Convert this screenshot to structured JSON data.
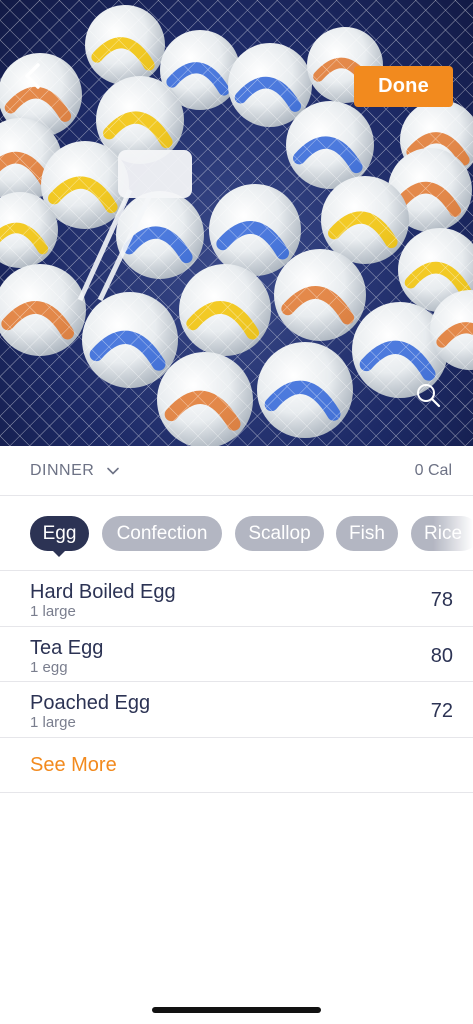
{
  "header": {
    "back_icon": "chevron-left-icon",
    "done_label": "Done",
    "search_icon": "search-icon"
  },
  "meal": {
    "name": "DINNER",
    "dropdown_icon": "chevron-down-icon",
    "calories": "0 Cal"
  },
  "chips": [
    {
      "label": "Egg",
      "active": true
    },
    {
      "label": "Confection",
      "active": false
    },
    {
      "label": "Scallop",
      "active": false
    },
    {
      "label": "Fish",
      "active": false
    },
    {
      "label": "Rice",
      "active": false
    }
  ],
  "foods": [
    {
      "name": "Hard Boiled Egg",
      "serving": "1 large",
      "calories": "78"
    },
    {
      "name": "Tea Egg",
      "serving": "1 egg",
      "calories": "80"
    },
    {
      "name": "Poached Egg",
      "serving": "1 large",
      "calories": "72"
    }
  ],
  "see_more_label": "See More",
  "colors": {
    "accent": "#f28a1e",
    "chip_active": "#2c3354",
    "chip_inactive": "#b3b6c2",
    "text_primary": "#2c3354"
  }
}
